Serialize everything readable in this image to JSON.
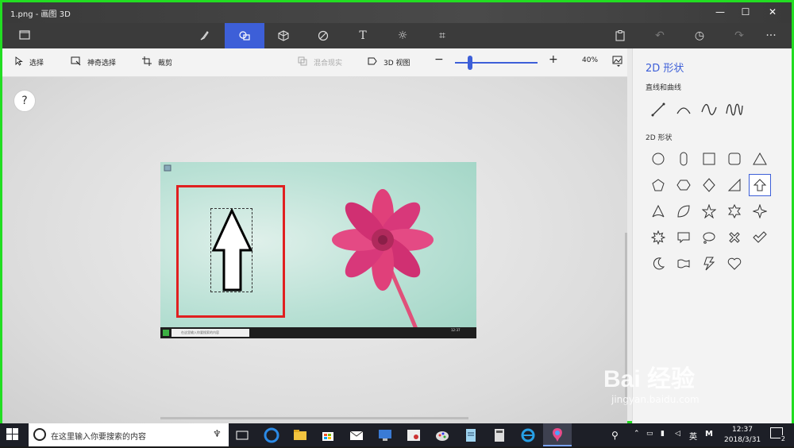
{
  "window": {
    "title": "1.png - 画图 3D",
    "minimize": "—",
    "maximize": "☐",
    "close": "✕"
  },
  "topbar": {
    "icons": [
      "menu-folder-icon",
      "brushes-icon",
      "2d-shapes-icon",
      "3d-shapes-icon",
      "stickers-icon",
      "text-icon",
      "effects-icon",
      "canvas-icon",
      "paste-icon",
      "undo-icon",
      "history-icon",
      "redo-icon",
      "more-icon"
    ],
    "more_label": "···",
    "active_color": "#3d5fd8"
  },
  "cmdbar": {
    "select_label": "选择",
    "magic_select_label": "神奇选择",
    "crop_label": "裁剪",
    "mix_reality_label": "混合现实",
    "view3d_label": "3D 视图",
    "zoom_minus": "−",
    "zoom_plus": "+",
    "zoom_level": "40%"
  },
  "canvas": {
    "help_label": "?",
    "mini_search_text": "在这里输入你要搜索的内容",
    "mini_clock": "12:37"
  },
  "panel": {
    "title": "2D 形状",
    "lines_label": "直线和曲线",
    "shapes_label": "2D 形状",
    "lines": [
      "line-icon",
      "curve-icon",
      "s-curve-icon",
      "wave-icon"
    ],
    "shapes": [
      [
        "circle-icon",
        "rounded-rect-vertical-icon",
        "square-icon",
        "rounded-square-icon",
        "triangle-icon"
      ],
      [
        "pentagon-icon",
        "hexagon-icon",
        "diamond-icon",
        "right-triangle-icon",
        "arrow-up-icon"
      ],
      [
        "concave-triangle-icon",
        "leaf-icon",
        "star5-icon",
        "star6-icon",
        "star4-icon"
      ],
      [
        "burst-icon",
        "speech-bubble-icon",
        "thought-bubble-icon",
        "cross-icon",
        "checkmark-icon"
      ],
      [
        "moon-icon",
        "flag-icon",
        "lightning-icon",
        "heart-icon"
      ]
    ]
  },
  "taskbar": {
    "search_placeholder": "在这里输入你要搜索的内容",
    "ime_label": "英",
    "ime2_label": "M",
    "time": "12:37",
    "date": "2018/3/31",
    "notification_count": "2"
  },
  "watermark": {
    "brand": "Bai 经验",
    "url": "jingyan.baidu.com"
  }
}
